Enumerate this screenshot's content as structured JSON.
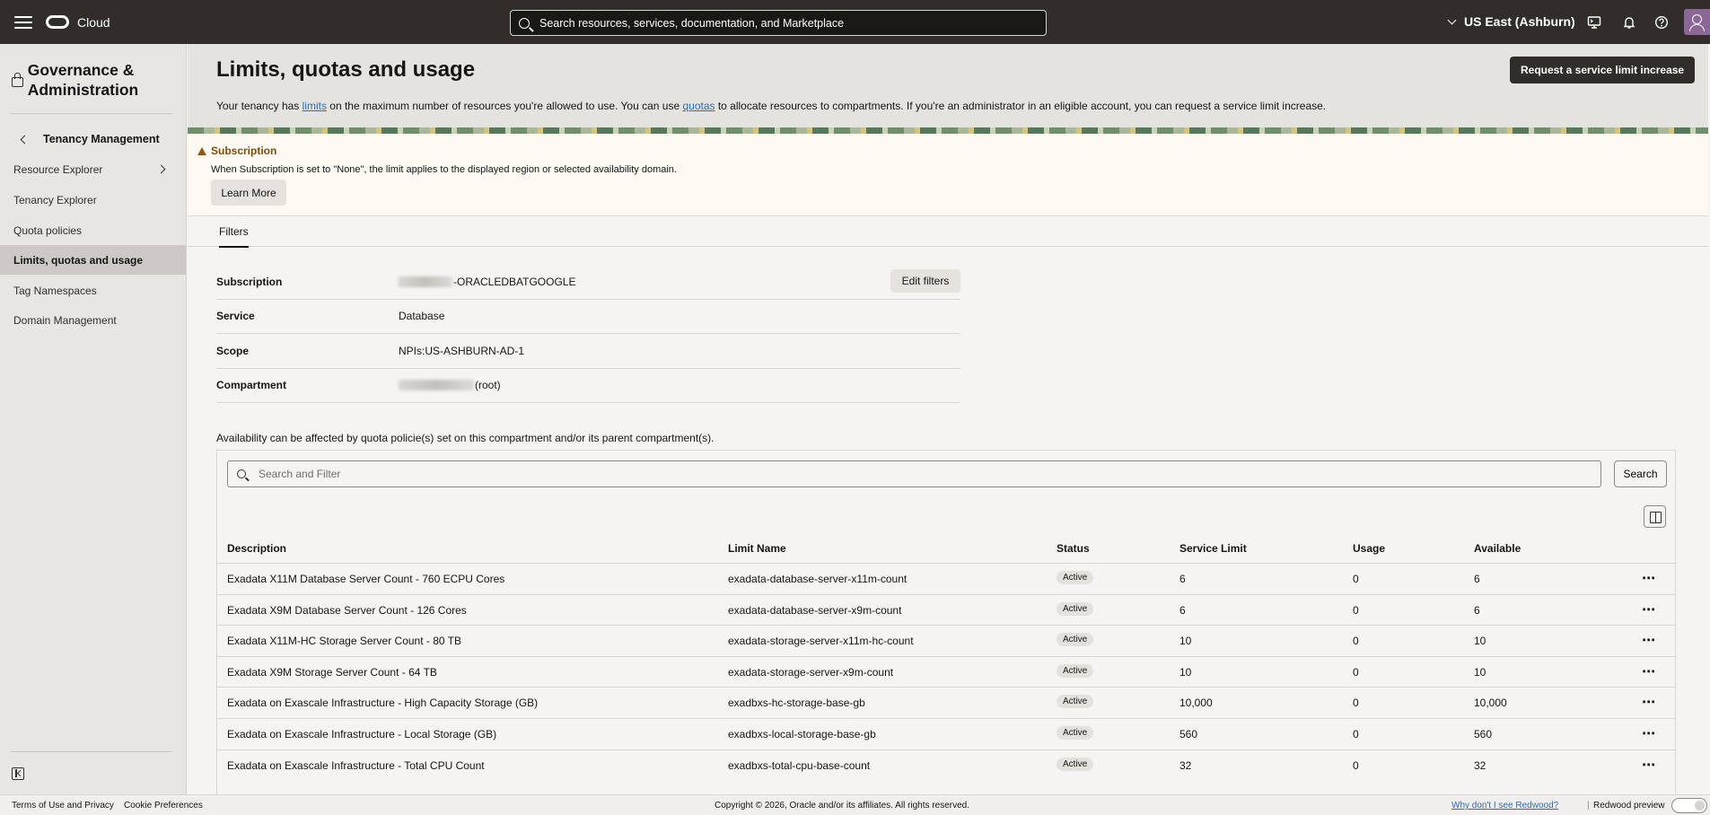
{
  "topbar": {
    "brand": "Cloud",
    "search_placeholder": "Search resources, services, documentation, and Marketplace",
    "region": "US East (Ashburn)"
  },
  "sidebar": {
    "section_title": "Governance & Administration",
    "back_label": "Tenancy Management",
    "items": [
      {
        "label": "Resource Explorer"
      },
      {
        "label": "Tenancy Explorer"
      },
      {
        "label": "Quota policies"
      },
      {
        "label": "Limits, quotas and usage"
      },
      {
        "label": "Tag Namespaces"
      },
      {
        "label": "Domain Management"
      }
    ]
  },
  "page": {
    "title": "Limits, quotas and usage",
    "request_button": "Request a service limit increase",
    "intro_a": "Your tenancy has ",
    "intro_link_limits": "limits",
    "intro_b": " on the maximum number of resources you're allowed to use. You can use ",
    "intro_link_quotas": "quotas",
    "intro_c": " to allocate resources to compartments. If you're an administrator in an eligible account, you can request a service limit increase."
  },
  "alert": {
    "title": "Subscription",
    "text": "When Subscription is set to \"None\", the limit applies to the displayed region or selected availability domain.",
    "button": "Learn More"
  },
  "tabs": {
    "filters": "Filters"
  },
  "filters": {
    "subscription_label": "Subscription",
    "subscription_value": "-ORACLEDBATGOOGLE",
    "service_label": "Service",
    "service_value": "Database",
    "scope_label": "Scope",
    "scope_value": "NPIs:US-ASHBURN-AD-1",
    "compartment_label": "Compartment",
    "compartment_value": " (root)",
    "edit_button": "Edit filters"
  },
  "availability_note": "Availability can be affected by quota policie(s) set on this compartment and/or its parent compartment(s).",
  "table": {
    "search_placeholder": "Search and Filter",
    "search_button": "Search",
    "headers": {
      "description": "Description",
      "limit_name": "Limit Name",
      "status": "Status",
      "service_limit": "Service Limit",
      "usage": "Usage",
      "available": "Available"
    },
    "actions_glyph": "⋯",
    "rows": [
      {
        "description": "Exadata X11M Database Server Count - 760 ECPU Cores",
        "limit_name": "exadata-database-server-x11m-count",
        "status": "Active",
        "service_limit": "6",
        "usage": "0",
        "available": "6"
      },
      {
        "description": "Exadata X9M Database Server Count - 126 Cores",
        "limit_name": "exadata-database-server-x9m-count",
        "status": "Active",
        "service_limit": "6",
        "usage": "0",
        "available": "6"
      },
      {
        "description": "Exadata X11M-HC Storage Server Count - 80 TB",
        "limit_name": "exadata-storage-server-x11m-hc-count",
        "status": "Active",
        "service_limit": "10",
        "usage": "0",
        "available": "10"
      },
      {
        "description": "Exadata X9M Storage Server Count - 64 TB",
        "limit_name": "exadata-storage-server-x9m-count",
        "status": "Active",
        "service_limit": "10",
        "usage": "0",
        "available": "10"
      },
      {
        "description": "Exadata on Exascale Infrastructure - High Capacity Storage (GB)",
        "limit_name": "exadbxs-hc-storage-base-gb",
        "status": "Active",
        "service_limit": "10,000",
        "usage": "0",
        "available": "10,000"
      },
      {
        "description": "Exadata on Exascale Infrastructure - Local Storage (GB)",
        "limit_name": "exadbxs-local-storage-base-gb",
        "status": "Active",
        "service_limit": "560",
        "usage": "0",
        "available": "560"
      },
      {
        "description": "Exadata on Exascale Infrastructure - Total CPU Count",
        "limit_name": "exadbxs-total-cpu-base-count",
        "status": "Active",
        "service_limit": "32",
        "usage": "0",
        "available": "32"
      }
    ]
  },
  "footer": {
    "terms": "Terms of Use and Privacy",
    "cookies": "Cookie Preferences",
    "copyright": "Copyright © 2026, Oracle and/or its affiliates. All rights reserved.",
    "redwood_why": "Why don't I see Redwood?",
    "separator": "|",
    "redwood_preview": "Redwood preview"
  }
}
